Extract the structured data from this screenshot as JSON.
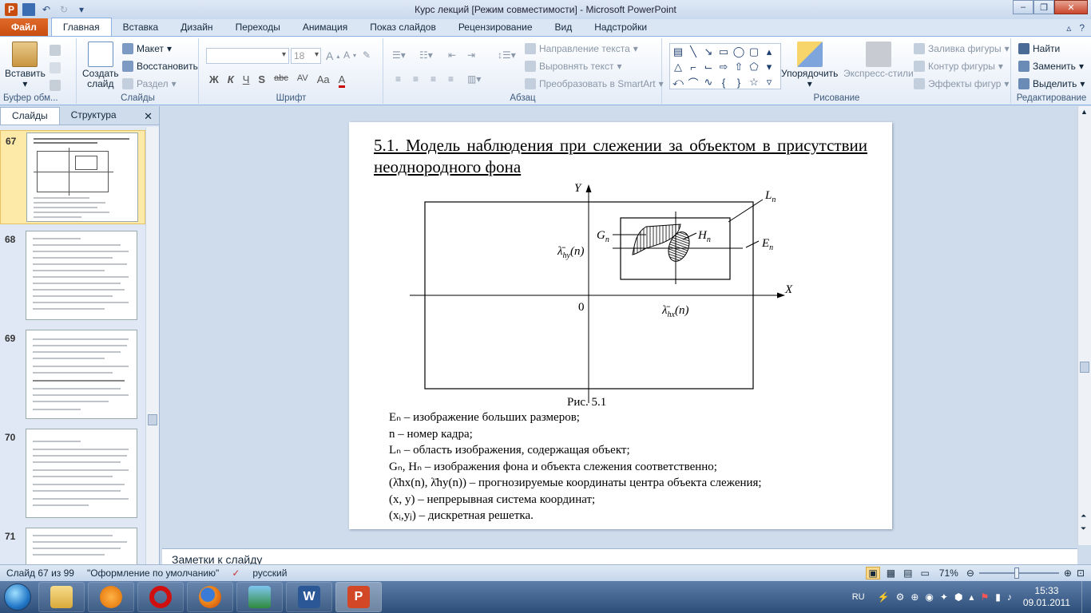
{
  "window": {
    "title": "Курс лекций [Режим совместимости]  -  Microsoft PowerPoint",
    "buttons": {
      "minimize": "–",
      "maximize": "❐",
      "close": "✕"
    }
  },
  "tabs": [
    "Файл",
    "Главная",
    "Вставка",
    "Дизайн",
    "Переходы",
    "Анимация",
    "Показ слайдов",
    "Рецензирование",
    "Вид",
    "Надстройки"
  ],
  "ribbon": {
    "clipboard": {
      "paste": "Вставить",
      "label": "Буфер обм..."
    },
    "slides": {
      "new_slide_1": "Создать",
      "new_slide_2": "слайд",
      "layout": "Макет",
      "reset": "Восстановить",
      "section": "Раздел",
      "label": "Слайды"
    },
    "font": {
      "size": "18",
      "bold": "Ж",
      "italic": "К",
      "underline": "Ч",
      "shadow": "S",
      "strike": "abc",
      "spacing": "AV",
      "case": "Aa",
      "color": "A",
      "label": "Шрифт"
    },
    "paragraph": {
      "text_direction": "Направление текста",
      "align_text": "Выровнять текст",
      "smartart": "Преобразовать в SmartArt",
      "label": "Абзац"
    },
    "drawing": {
      "arrange": "Упорядочить",
      "quick_styles": "Экспресс-стили",
      "shape_fill": "Заливка фигуры",
      "shape_outline": "Контур фигуры",
      "shape_effects": "Эффекты фигур",
      "label": "Рисование"
    },
    "editing": {
      "find": "Найти",
      "replace": "Заменить",
      "select": "Выделить",
      "label": "Редактирование"
    }
  },
  "panel": {
    "tab_slides": "Слайды",
    "tab_outline": "Структура",
    "close": "✕",
    "thumbnails": [
      {
        "number": "67"
      },
      {
        "number": "68"
      },
      {
        "number": "69"
      },
      {
        "number": "70"
      },
      {
        "number": "71"
      }
    ]
  },
  "slide": {
    "title": "5.1. Модель наблюдения при слежении за объектом в присутствии неоднородного фона",
    "figure": {
      "axis_y": "Y",
      "axis_x": "X",
      "origin": "0",
      "L": "L",
      "L_sub": "n",
      "G": "G",
      "G_sub": "n",
      "H": "H",
      "H_sub": "n",
      "E": "E",
      "E_sub": "n",
      "lambda_y": "λ̄",
      "lambda_y_sub": "hy",
      "lambda_y_arg": "(n)",
      "lambda_x": "λ̄",
      "lambda_x_sub": "hx",
      "lambda_x_arg": "(n)",
      "caption": "Рис. 5.1"
    },
    "legend": [
      "Eₙ – изображение  больших  размеров;",
      "n – номер кадра;",
      "Lₙ – область изображения,  содержащая объект;",
      "Gₙ, Hₙ – изображения  фона и объекта слежения  соответственно;",
      "(λ̄hx(n), λ̄hy(n)) – прогнозируемые  координаты  центра  объекта слежения;",
      "(x, y) – непрерывная   система координат;",
      "(xᵢ,yⱼ) – дискретная  решетка."
    ]
  },
  "notes": {
    "placeholder": "Заметки к слайду"
  },
  "status": {
    "slide_counter": "Слайд 67 из 99",
    "theme": "\"Оформление по умолчанию\"",
    "language": "русский",
    "zoom": "71%"
  },
  "taskbar": {
    "lang": "RU",
    "time": "15:33",
    "date": "09.01.2011"
  }
}
